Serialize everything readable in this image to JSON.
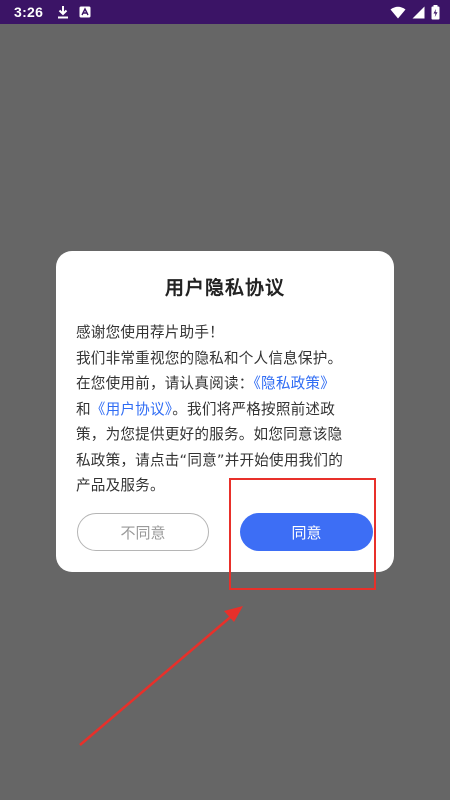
{
  "status_bar": {
    "time": "3:26",
    "icons": [
      "download-icon",
      "app-notification-icon",
      "wifi-icon",
      "signal-icon",
      "battery-icon"
    ]
  },
  "dialog": {
    "title": "用户隐私协议",
    "body": {
      "line1": "感谢您使用荐片助手！",
      "line2": "我们非常重视您的隐私和个人信息保护。",
      "line3_prefix": "在您使用前，请认真阅读：",
      "privacy_link": "《隐私政策》",
      "line4_prefix": "和",
      "user_agreement_link": "《用户协议》",
      "line4_suffix": "。我们将严格按照前述政",
      "line5": "策，为您提供更好的服务。如您同意该隐",
      "line6": "私政策，请点击“同意”并开始使用我们的",
      "line7": "产品及服务。"
    },
    "disagree_label": "不同意",
    "agree_label": "同意"
  },
  "colors": {
    "status_bar": "#3b1466",
    "backdrop": "#666666",
    "link": "#2f6cf4",
    "agree_button": "#3d6ef5",
    "annotation": "#e8302a"
  }
}
